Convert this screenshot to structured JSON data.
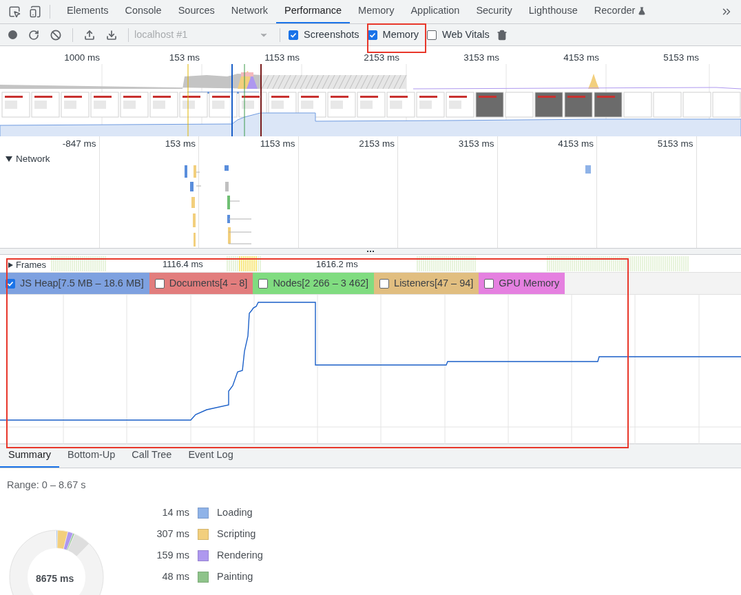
{
  "tabs": [
    {
      "label": "Elements",
      "selected": false
    },
    {
      "label": "Console",
      "selected": false
    },
    {
      "label": "Sources",
      "selected": false
    },
    {
      "label": "Network",
      "selected": false
    },
    {
      "label": "Performance",
      "selected": true
    },
    {
      "label": "Memory",
      "selected": false
    },
    {
      "label": "Application",
      "selected": false
    },
    {
      "label": "Security",
      "selected": false
    },
    {
      "label": "Lighthouse",
      "selected": false
    },
    {
      "label": "Recorder",
      "selected": false
    }
  ],
  "toolbar": {
    "profile_select": "localhost #1",
    "checkboxes": [
      {
        "label": "Screenshots",
        "checked": true
      },
      {
        "label": "Memory",
        "checked": true
      },
      {
        "label": "Web Vitals",
        "checked": false
      }
    ]
  },
  "overview": {
    "ticks": [
      "1000 ms",
      "153 ms",
      "1153 ms",
      "2153 ms",
      "3153 ms",
      "4153 ms",
      "5153 ms"
    ]
  },
  "ruler": {
    "ticks": [
      "-847 ms",
      "153 ms",
      "1153 ms",
      "2153 ms",
      "3153 ms",
      "4153 ms",
      "5153 ms"
    ]
  },
  "network": {
    "label": "Network",
    "expanded": true
  },
  "frames": {
    "label": "Frames",
    "expanded": false,
    "markers": [
      "1116.4 ms",
      "1616.2 ms"
    ]
  },
  "counters": [
    {
      "label": "JS Heap[7.5 MB – 18.6 MB]",
      "checked": true,
      "color": "#7ea1e0"
    },
    {
      "label": "Documents[4 – 8]",
      "checked": false,
      "color": "#e27d7d"
    },
    {
      "label": "Nodes[2 266 – 3 462]",
      "checked": false,
      "color": "#80dc80"
    },
    {
      "label": "Listeners[47 – 94]",
      "checked": false,
      "color": "#e1be80"
    },
    {
      "label": "GPU Memory",
      "checked": false,
      "color": "#e580e0"
    }
  ],
  "details_tabs": [
    {
      "label": "Summary",
      "selected": true
    },
    {
      "label": "Bottom-Up",
      "selected": false
    },
    {
      "label": "Call Tree",
      "selected": false
    },
    {
      "label": "Event Log",
      "selected": false
    }
  ],
  "summary": {
    "range": "Range: 0 – 8.67 s",
    "total": "8675 ms",
    "categories": [
      {
        "time": "14 ms",
        "label": "Loading",
        "color": "#8fb3e8"
      },
      {
        "time": "307 ms",
        "label": "Scripting",
        "color": "#f2cf7d"
      },
      {
        "time": "159 ms",
        "label": "Rendering",
        "color": "#ae98ef"
      },
      {
        "time": "48 ms",
        "label": "Painting",
        "color": "#8ec38a"
      }
    ]
  }
}
